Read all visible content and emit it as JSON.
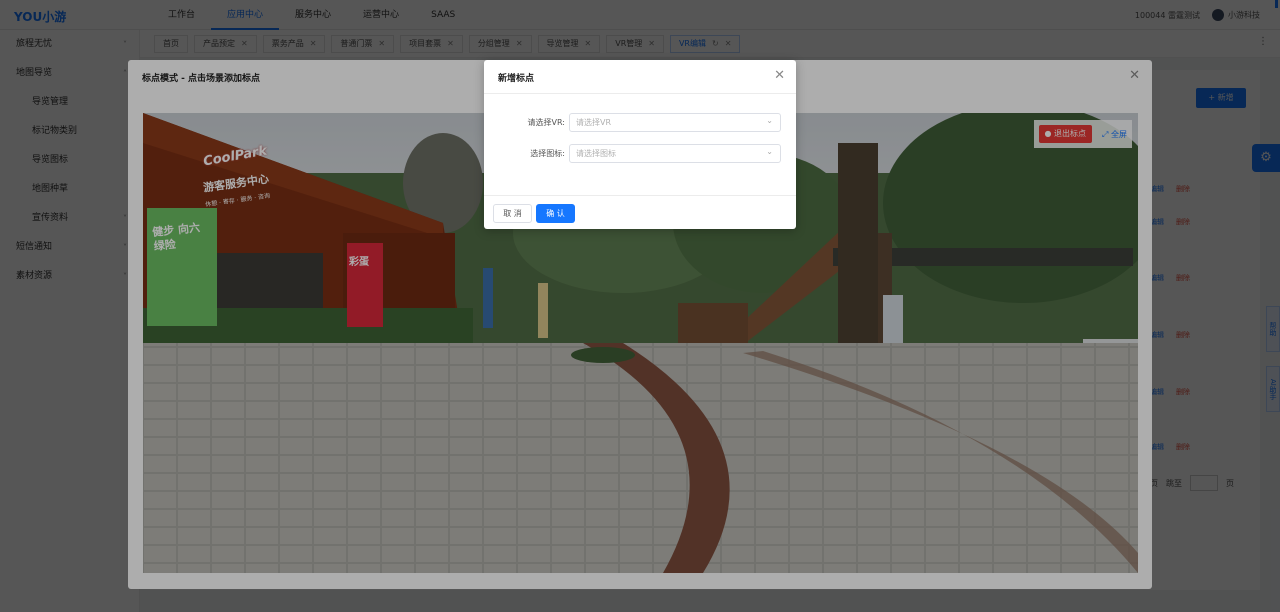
{
  "app": {
    "logo": "YOU小游"
  },
  "nav": [
    "工作台",
    "应用中心",
    "服务中心",
    "运营中心",
    "SAAS"
  ],
  "nav_active_index": 1,
  "user": {
    "account": "100044 雷霆测试",
    "company": "小游科技"
  },
  "sidebar": [
    {
      "label": "旅程无忧",
      "chevron": "˅"
    },
    {
      "label": "地图导览",
      "chevron": "˄"
    },
    {
      "label": "导览管理",
      "sub": true
    },
    {
      "label": "标记物类别",
      "sub": true
    },
    {
      "label": "导览图标",
      "sub": true
    },
    {
      "label": "地图种草",
      "sub": true
    },
    {
      "label": "宣传资料",
      "sub": true,
      "chevron": "˅"
    },
    {
      "label": "短信通知",
      "chevron": "˅"
    },
    {
      "label": "素材资源",
      "chevron": "˅"
    }
  ],
  "tabs": [
    {
      "label": "首页"
    },
    {
      "label": "产品预定",
      "closable": true
    },
    {
      "label": "票务产品",
      "closable": true
    },
    {
      "label": "普通门票",
      "closable": true
    },
    {
      "label": "项目套票",
      "closable": true
    },
    {
      "label": "分组管理",
      "closable": true
    },
    {
      "label": "导览管理",
      "closable": true
    },
    {
      "label": "VR管理",
      "closable": true
    },
    {
      "label": "VR编辑",
      "closable": true,
      "active": true
    }
  ],
  "content": {
    "add_button": "+ 新增",
    "row_edit": "编辑",
    "row_delete": "删除",
    "pager_suffix": "页",
    "pager_jump": "跳至",
    "pager_page": "页"
  },
  "side_tags": [
    "帮助",
    "AI助手"
  ],
  "big_dialog": {
    "title": "标点模式 - 点击场景添加标点",
    "exit_button": "退出标点",
    "fullscreen_button": "全屏",
    "scene_signs": {
      "brand": "CoolPark",
      "hall": "游客服务中心",
      "hall_sub": "休憩 · 寄存 · 服务 · 咨询",
      "banner_left": "健步 向六绿险",
      "banner_mid": "彩蛋"
    }
  },
  "small_dialog": {
    "title": "新增标点",
    "fields": [
      {
        "label": "请选择VR:",
        "placeholder": "请选择VR",
        "value": ""
      },
      {
        "label": "选择图标:",
        "placeholder": "请选择图标",
        "value": ""
      }
    ],
    "cancel": "取 消",
    "confirm": "确 认"
  },
  "colors": {
    "primary": "#1677ff",
    "danger": "#e53935",
    "mask": "#000000"
  },
  "icons": {
    "close": "close-icon",
    "arrow": "chevron-down-icon",
    "pin": "map-pin-icon",
    "expand": "expand-icon",
    "settings": "gear-icon"
  }
}
